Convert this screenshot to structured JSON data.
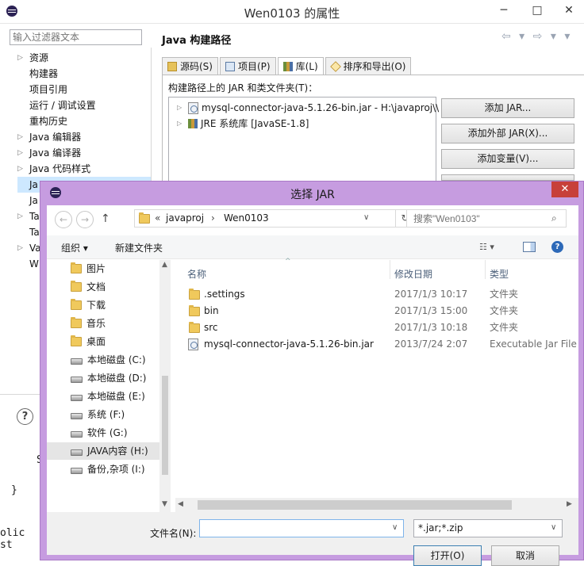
{
  "window": {
    "title": "Wen0103 的属性",
    "min": "─",
    "max": "□",
    "close": "✕",
    "filter_placeholder": "输入过滤器文本",
    "help": "?",
    "nav_items": [
      {
        "label": "资源",
        "expandable": true
      },
      {
        "label": "构建器",
        "expandable": false
      },
      {
        "label": "项目引用",
        "expandable": false
      },
      {
        "label": "运行 / 调试设置",
        "expandable": false
      },
      {
        "label": "重构历史",
        "expandable": false
      },
      {
        "label": "Java 编辑器",
        "expandable": true
      },
      {
        "label": "Java 编译器",
        "expandable": true
      },
      {
        "label": "Java 代码样式",
        "expandable": true
      },
      {
        "label": "Ja",
        "expandable": false,
        "selected": true
      },
      {
        "label": "Ja",
        "expandable": false
      },
      {
        "label": "Ta",
        "expandable": true
      },
      {
        "label": "Ta",
        "expandable": false
      },
      {
        "label": "Va",
        "expandable": true
      },
      {
        "label": "W",
        "expandable": false
      }
    ],
    "section_title": "Java 构建路径",
    "nav_arrows": "⇦ ▾ ⇨ ▾ ▾",
    "tabs": [
      {
        "label": "源码(S)",
        "icon": "source-folder-icon"
      },
      {
        "label": "项目(P)",
        "icon": "project-icon"
      },
      {
        "label": "库(L)",
        "icon": "library-icon",
        "active": true
      },
      {
        "label": "排序和导出(O)",
        "icon": "order-export-icon"
      }
    ],
    "panel_label": "构建路径上的 JAR 和类文件夹(T)：",
    "jar_entries": [
      {
        "label": "mysql-connector-java-5.1.26-bin.jar - H:\\javaproj\\\\"
      },
      {
        "label": "JRE 系统库 [JavaSE-1.8]"
      }
    ],
    "side_buttons": [
      "添加 JAR...",
      "添加外部 JAR(X)...",
      "添加变量(V)..."
    ],
    "code_lines": [
      "S",
      "}",
      "olic st"
    ]
  },
  "dialog": {
    "title": "选择 JAR",
    "close": "✕",
    "back": "←",
    "forward": "→",
    "up": "↑",
    "path": [
      "javaproj",
      "Wen0103"
    ],
    "path_prefix": "«",
    "path_sep": "›",
    "refresh": "↻",
    "search_placeholder": "搜索\"Wen0103\"",
    "organize": "组织 ▾",
    "new_folder": "新建文件夹",
    "view_icons": [
      "view-mode-icon",
      "preview-pane-icon",
      "help-icon"
    ],
    "help": "?",
    "left_items": [
      {
        "label": "图片",
        "icon": "folder-icon"
      },
      {
        "label": "文档",
        "icon": "folder-icon"
      },
      {
        "label": "下载",
        "icon": "folder-icon"
      },
      {
        "label": "音乐",
        "icon": "folder-icon"
      },
      {
        "label": "桌面",
        "icon": "folder-icon"
      },
      {
        "label": "本地磁盘 (C:)",
        "icon": "drive-icon"
      },
      {
        "label": "本地磁盘 (D:)",
        "icon": "drive-icon"
      },
      {
        "label": "本地磁盘 (E:)",
        "icon": "drive-icon"
      },
      {
        "label": "系统 (F:)",
        "icon": "drive-icon"
      },
      {
        "label": "软件 (G:)",
        "icon": "drive-icon"
      },
      {
        "label": "JAVA内容 (H:)",
        "icon": "drive-icon",
        "selected": true
      },
      {
        "label": "备份,杂项 (I:)",
        "icon": "drive-icon"
      }
    ],
    "columns": {
      "name": "名称",
      "date": "修改日期",
      "type": "类型"
    },
    "files": [
      {
        "name": ".settings",
        "date": "2017/1/3 10:17",
        "type": "文件夹",
        "icon": "folder-icon"
      },
      {
        "name": "bin",
        "date": "2017/1/3 15:00",
        "type": "文件夹",
        "icon": "folder-icon"
      },
      {
        "name": "src",
        "date": "2017/1/3 10:18",
        "type": "文件夹",
        "icon": "folder-icon"
      },
      {
        "name": "mysql-connector-java-5.1.26-bin.jar",
        "date": "2013/7/24 2:07",
        "type": "Executable Jar File",
        "icon": "jar-file-icon"
      }
    ],
    "filename_label": "文件名(N):",
    "filename_value": "",
    "filetype": "*.jar;*.zip",
    "open": "打开(O)",
    "cancel": "取消"
  },
  "colors": {
    "dialog_frame": "#c69ce0",
    "close_red": "#c7403a",
    "selection": "#cde8ff"
  }
}
